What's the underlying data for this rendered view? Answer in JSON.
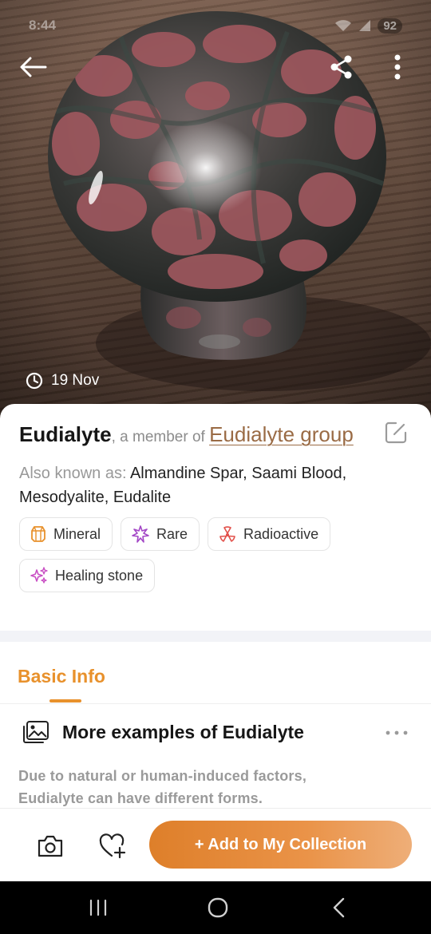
{
  "status_bar": {
    "time": "8:44",
    "battery": "92"
  },
  "header": {
    "date": "19 Nov"
  },
  "mineral": {
    "name": "Eudialyte",
    "member_text": ", a member of ",
    "group_name": "Eudialyte group",
    "aka_label": "Also known as: ",
    "aka_values": "Almandine Spar, Saami Blood, Mesodyalite, Eudalite"
  },
  "tags": [
    {
      "label": "Mineral",
      "icon": "mineral-icon",
      "color": "#e8912c"
    },
    {
      "label": "Rare",
      "icon": "rare-icon",
      "color": "#a347c6"
    },
    {
      "label": "Radioactive",
      "icon": "radioactive-icon",
      "color": "#e2504a"
    },
    {
      "label": "Healing stone",
      "icon": "healing-stone-icon",
      "color": "#c94fc4"
    }
  ],
  "tabs": {
    "active": "Basic Info"
  },
  "section": {
    "title": "More examples of Eudialyte",
    "description": "Due to natural or human-induced factors, Eudialyte can have different forms."
  },
  "bottom_bar": {
    "cta": "+ Add to My Collection"
  },
  "colors": {
    "accent": "#e8912c",
    "link": "#9a6b45"
  }
}
